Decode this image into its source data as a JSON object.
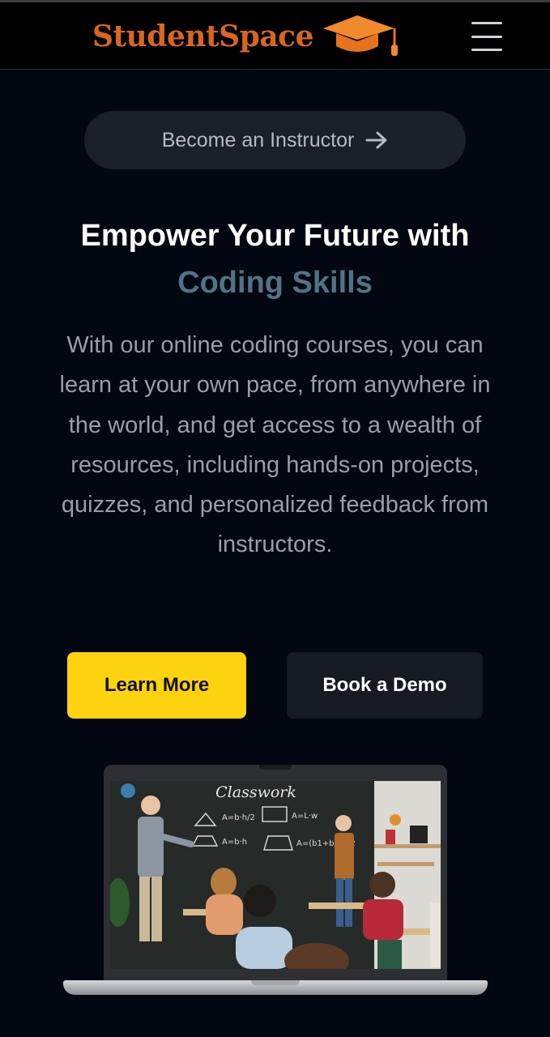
{
  "header": {
    "logo_text": "StudentSpace",
    "logo_icon": "graduation-cap-icon",
    "menu_icon": "hamburger-menu-icon",
    "brand_color": "#d9661f"
  },
  "hero": {
    "instructor_pill_label": "Become an Instructor",
    "headline_line1": "Empower Your Future with",
    "headline_accent": "Coding Skills",
    "description": "With our online coding courses, you can learn at your own pace, from anywhere in the world, and get access to a wealth of resources, including hands-on projects, quizzes, and personalized feedback from instructors.",
    "primary_button": "Learn More",
    "secondary_button": "Book a Demo",
    "accent_color": "#4f7483",
    "primary_button_color": "#fdd20e"
  },
  "illustration": {
    "blackboard_title": "Classwork",
    "formulas": [
      "A=b·h/2",
      "A=L·w",
      "A=b·h",
      "A=(b1+b2)h/2"
    ]
  }
}
